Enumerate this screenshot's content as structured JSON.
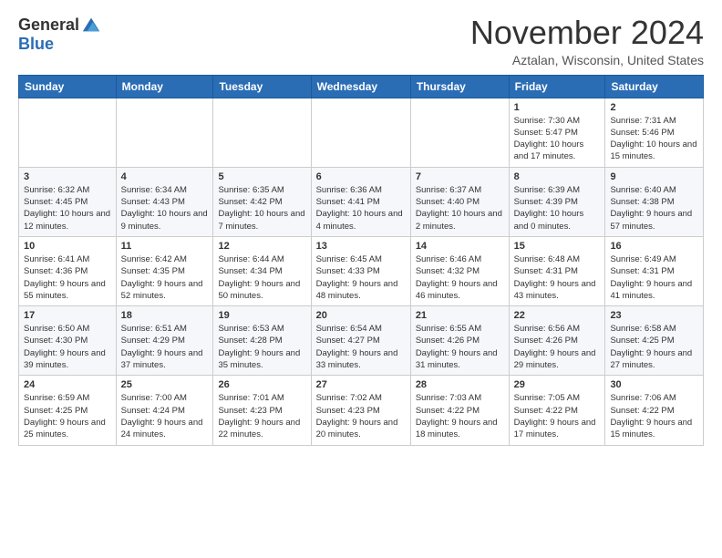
{
  "logo": {
    "general": "General",
    "blue": "Blue"
  },
  "header": {
    "month": "November 2024",
    "location": "Aztalan, Wisconsin, United States"
  },
  "weekdays": [
    "Sunday",
    "Monday",
    "Tuesday",
    "Wednesday",
    "Thursday",
    "Friday",
    "Saturday"
  ],
  "weeks": [
    [
      {
        "day": "",
        "info": ""
      },
      {
        "day": "",
        "info": ""
      },
      {
        "day": "",
        "info": ""
      },
      {
        "day": "",
        "info": ""
      },
      {
        "day": "",
        "info": ""
      },
      {
        "day": "1",
        "info": "Sunrise: 7:30 AM\nSunset: 5:47 PM\nDaylight: 10 hours and 17 minutes."
      },
      {
        "day": "2",
        "info": "Sunrise: 7:31 AM\nSunset: 5:46 PM\nDaylight: 10 hours and 15 minutes."
      }
    ],
    [
      {
        "day": "3",
        "info": "Sunrise: 6:32 AM\nSunset: 4:45 PM\nDaylight: 10 hours and 12 minutes."
      },
      {
        "day": "4",
        "info": "Sunrise: 6:34 AM\nSunset: 4:43 PM\nDaylight: 10 hours and 9 minutes."
      },
      {
        "day": "5",
        "info": "Sunrise: 6:35 AM\nSunset: 4:42 PM\nDaylight: 10 hours and 7 minutes."
      },
      {
        "day": "6",
        "info": "Sunrise: 6:36 AM\nSunset: 4:41 PM\nDaylight: 10 hours and 4 minutes."
      },
      {
        "day": "7",
        "info": "Sunrise: 6:37 AM\nSunset: 4:40 PM\nDaylight: 10 hours and 2 minutes."
      },
      {
        "day": "8",
        "info": "Sunrise: 6:39 AM\nSunset: 4:39 PM\nDaylight: 10 hours and 0 minutes."
      },
      {
        "day": "9",
        "info": "Sunrise: 6:40 AM\nSunset: 4:38 PM\nDaylight: 9 hours and 57 minutes."
      }
    ],
    [
      {
        "day": "10",
        "info": "Sunrise: 6:41 AM\nSunset: 4:36 PM\nDaylight: 9 hours and 55 minutes."
      },
      {
        "day": "11",
        "info": "Sunrise: 6:42 AM\nSunset: 4:35 PM\nDaylight: 9 hours and 52 minutes."
      },
      {
        "day": "12",
        "info": "Sunrise: 6:44 AM\nSunset: 4:34 PM\nDaylight: 9 hours and 50 minutes."
      },
      {
        "day": "13",
        "info": "Sunrise: 6:45 AM\nSunset: 4:33 PM\nDaylight: 9 hours and 48 minutes."
      },
      {
        "day": "14",
        "info": "Sunrise: 6:46 AM\nSunset: 4:32 PM\nDaylight: 9 hours and 46 minutes."
      },
      {
        "day": "15",
        "info": "Sunrise: 6:48 AM\nSunset: 4:31 PM\nDaylight: 9 hours and 43 minutes."
      },
      {
        "day": "16",
        "info": "Sunrise: 6:49 AM\nSunset: 4:31 PM\nDaylight: 9 hours and 41 minutes."
      }
    ],
    [
      {
        "day": "17",
        "info": "Sunrise: 6:50 AM\nSunset: 4:30 PM\nDaylight: 9 hours and 39 minutes."
      },
      {
        "day": "18",
        "info": "Sunrise: 6:51 AM\nSunset: 4:29 PM\nDaylight: 9 hours and 37 minutes."
      },
      {
        "day": "19",
        "info": "Sunrise: 6:53 AM\nSunset: 4:28 PM\nDaylight: 9 hours and 35 minutes."
      },
      {
        "day": "20",
        "info": "Sunrise: 6:54 AM\nSunset: 4:27 PM\nDaylight: 9 hours and 33 minutes."
      },
      {
        "day": "21",
        "info": "Sunrise: 6:55 AM\nSunset: 4:26 PM\nDaylight: 9 hours and 31 minutes."
      },
      {
        "day": "22",
        "info": "Sunrise: 6:56 AM\nSunset: 4:26 PM\nDaylight: 9 hours and 29 minutes."
      },
      {
        "day": "23",
        "info": "Sunrise: 6:58 AM\nSunset: 4:25 PM\nDaylight: 9 hours and 27 minutes."
      }
    ],
    [
      {
        "day": "24",
        "info": "Sunrise: 6:59 AM\nSunset: 4:25 PM\nDaylight: 9 hours and 25 minutes."
      },
      {
        "day": "25",
        "info": "Sunrise: 7:00 AM\nSunset: 4:24 PM\nDaylight: 9 hours and 24 minutes."
      },
      {
        "day": "26",
        "info": "Sunrise: 7:01 AM\nSunset: 4:23 PM\nDaylight: 9 hours and 22 minutes."
      },
      {
        "day": "27",
        "info": "Sunrise: 7:02 AM\nSunset: 4:23 PM\nDaylight: 9 hours and 20 minutes."
      },
      {
        "day": "28",
        "info": "Sunrise: 7:03 AM\nSunset: 4:22 PM\nDaylight: 9 hours and 18 minutes."
      },
      {
        "day": "29",
        "info": "Sunrise: 7:05 AM\nSunset: 4:22 PM\nDaylight: 9 hours and 17 minutes."
      },
      {
        "day": "30",
        "info": "Sunrise: 7:06 AM\nSunset: 4:22 PM\nDaylight: 9 hours and 15 minutes."
      }
    ]
  ]
}
